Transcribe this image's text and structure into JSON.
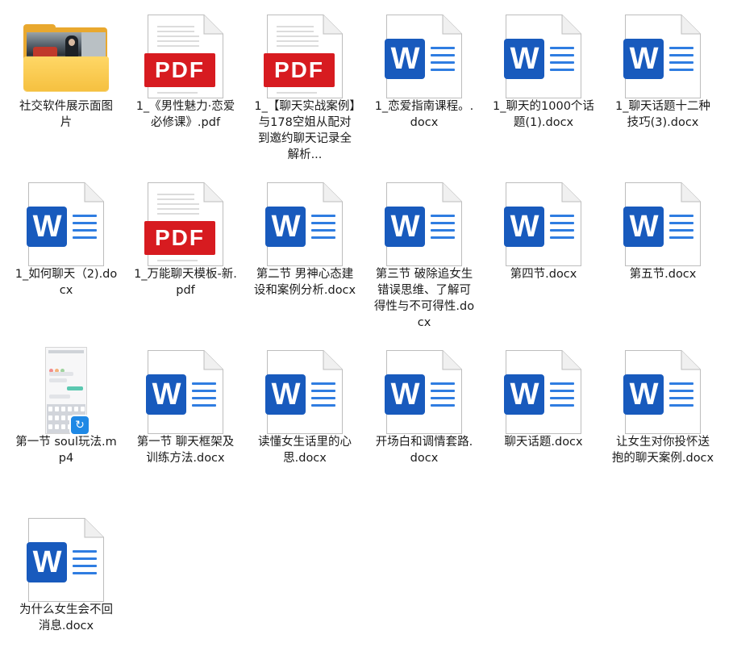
{
  "files": [
    {
      "type": "folder",
      "name": "社交软件展示面图片"
    },
    {
      "type": "pdf",
      "name": "1_《男性魅力·恋爱必修课》.pdf"
    },
    {
      "type": "pdf",
      "name": "1_【聊天实战案例】与178空姐从配对到邀约聊天记录全解析..."
    },
    {
      "type": "word",
      "name": "1_恋爱指南课程。.docx"
    },
    {
      "type": "word",
      "name": "1_聊天的1000个话题(1).docx"
    },
    {
      "type": "word",
      "name": "1_聊天话题十二种技巧(3).docx"
    },
    {
      "type": "word",
      "name": "1_如何聊天（2).docx"
    },
    {
      "type": "pdf",
      "name": "1_万能聊天模板-新.pdf"
    },
    {
      "type": "word",
      "name": "第二节 男神心态建设和案例分析.docx"
    },
    {
      "type": "word",
      "name": "第三节 破除追女生错误思维、了解可得性与不可得性.docx"
    },
    {
      "type": "word",
      "name": "第四节.docx"
    },
    {
      "type": "word",
      "name": "第五节.docx"
    },
    {
      "type": "video",
      "name": "第一节 soul玩法.mp4"
    },
    {
      "type": "word",
      "name": "第一节 聊天框架及训练方法.docx"
    },
    {
      "type": "word",
      "name": "读懂女生话里的心思.docx"
    },
    {
      "type": "word",
      "name": "开场白和调情套路.docx"
    },
    {
      "type": "word",
      "name": "聊天话题.docx"
    },
    {
      "type": "word",
      "name": "让女生对你投怀送抱的聊天案例.docx"
    },
    {
      "type": "word",
      "name": "为什么女生会不回消息.docx"
    }
  ],
  "icons": {
    "word_badge": "W",
    "pdf_badge": "PDF",
    "word_color": "#185abd",
    "pdf_color": "#d71b20",
    "folder_color": "#f5c03f"
  }
}
